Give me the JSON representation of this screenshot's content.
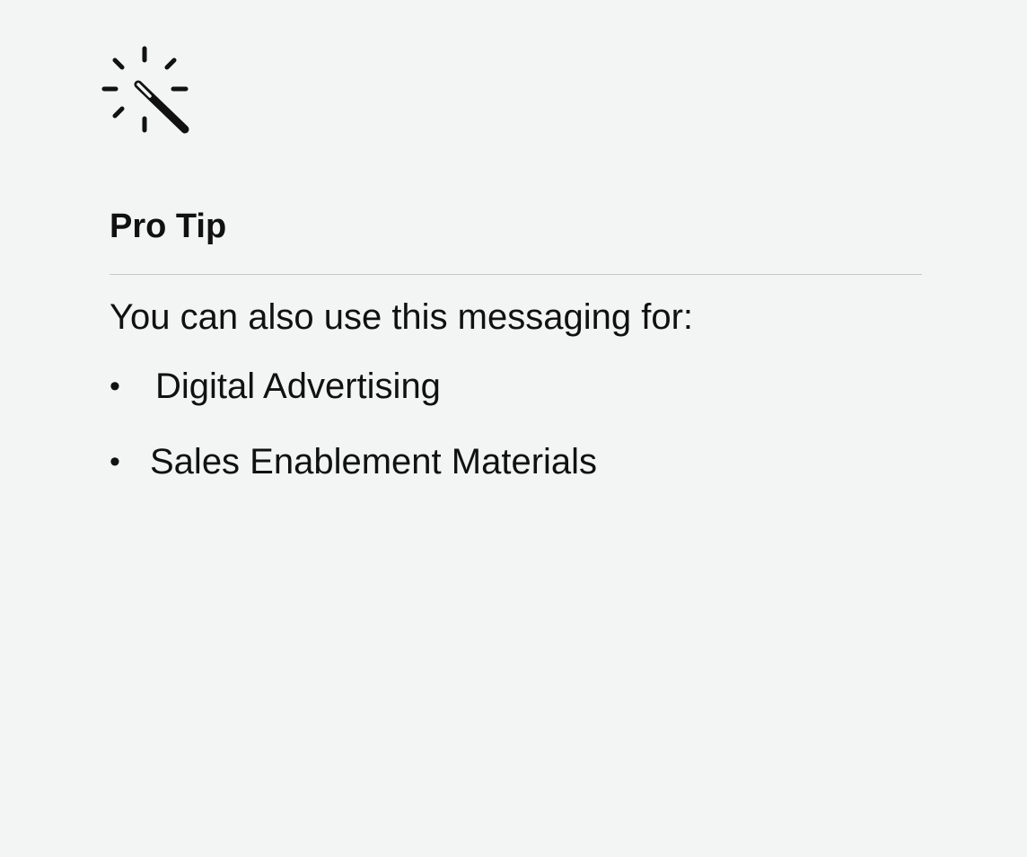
{
  "tip": {
    "icon": "magic-wand-icon",
    "title": "Pro Tip",
    "intro": "You can also use this messaging for:",
    "bullet": "•",
    "items": [
      {
        "label": "Digital Advertising"
      },
      {
        "label": "Sales Enablement Materials"
      }
    ]
  },
  "colors": {
    "background": "#f3f4f4",
    "text": "#111111",
    "divider": "#c9c9c9"
  }
}
